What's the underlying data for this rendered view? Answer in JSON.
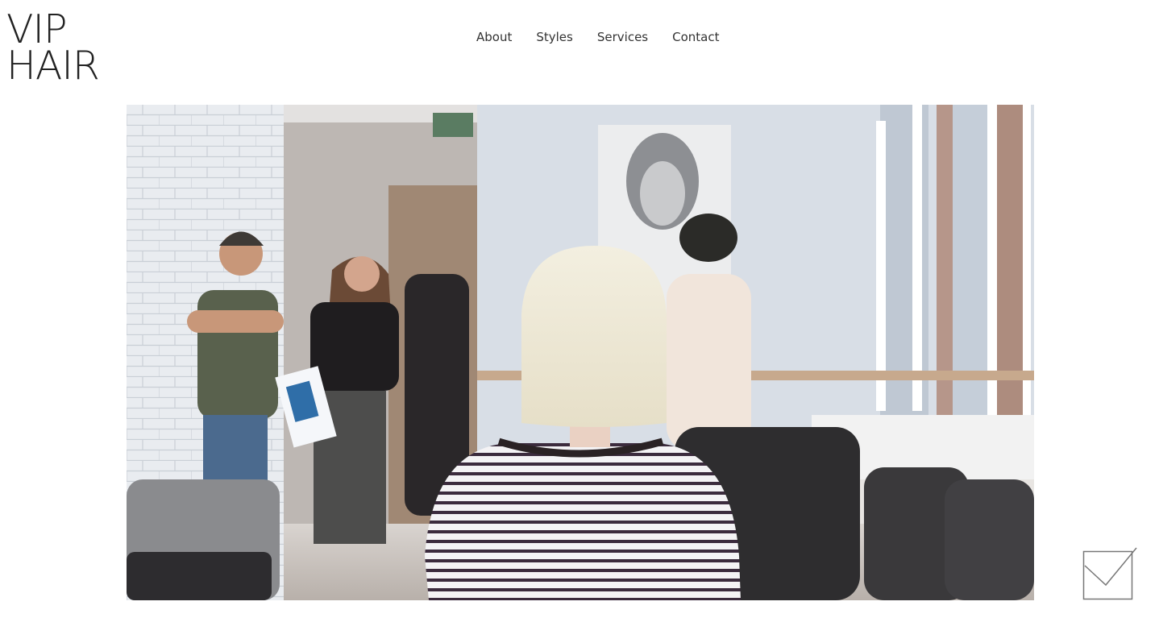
{
  "logo": {
    "line1": "VIP",
    "line2": "HAIR"
  },
  "nav": {
    "items": [
      {
        "label": "About"
      },
      {
        "label": "Styles"
      },
      {
        "label": "Services"
      },
      {
        "label": "Contact"
      }
    ]
  },
  "hero": {
    "alt": "Salon interior with a blonde bob-haired woman in a striped shirt facing stylists"
  },
  "fab": {
    "icon": "checkbox-check-icon"
  },
  "colors": {
    "text": "#222222",
    "nav_text": "#333333",
    "background": "#ffffff"
  }
}
